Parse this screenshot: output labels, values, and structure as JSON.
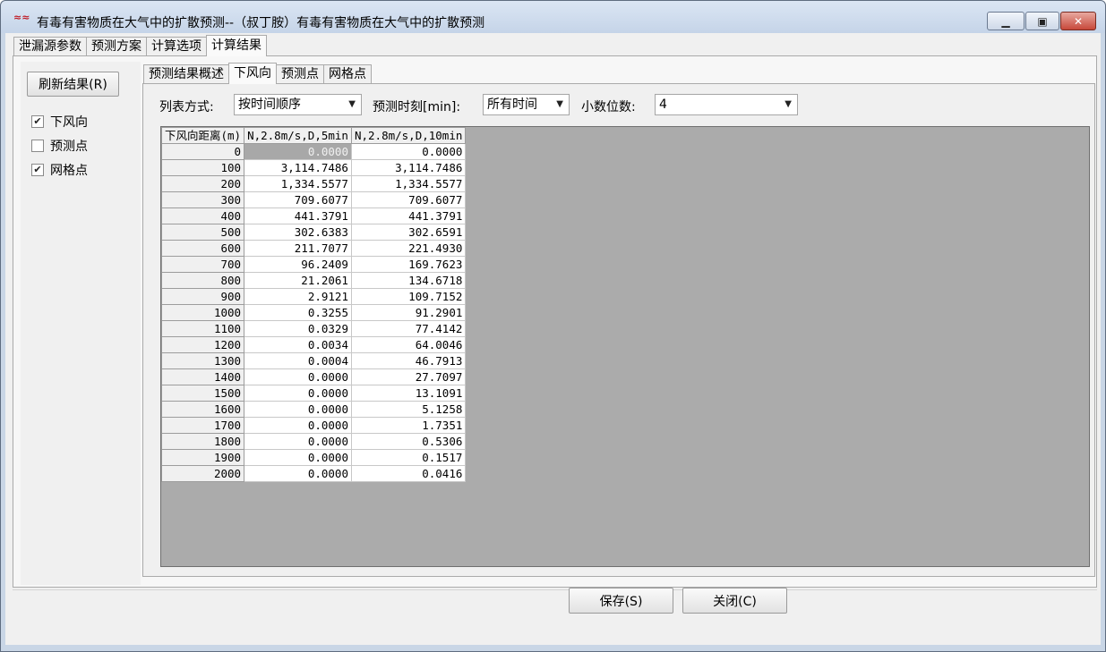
{
  "window": {
    "title": "有毒有害物质在大气中的扩散预测--（叔丁胺）有毒有害物质在大气中的扩散预测",
    "minimize_label": "▁",
    "maximize_label": "▣",
    "close_label": "✕"
  },
  "top_tabs": [
    "泄漏源参数",
    "预测方案",
    "计算选项",
    "计算结果"
  ],
  "left_panel": {
    "refresh_label": "刷新结果(R)",
    "checkboxes": [
      {
        "label": "下风向",
        "checked": true
      },
      {
        "label": "预测点",
        "checked": false
      },
      {
        "label": "网格点",
        "checked": true
      }
    ]
  },
  "inner_tabs": [
    "预测结果概述",
    "下风向",
    "预测点",
    "网格点"
  ],
  "controls": {
    "list_mode_label": "列表方式:",
    "list_mode_value": "按时间顺序",
    "time_label": "预测时刻[min]:",
    "time_value": "所有时间",
    "decimals_label": "小数位数:",
    "decimals_value": "4"
  },
  "table": {
    "headers": [
      "下风向距离(m)",
      "N,2.8m/s,D,5min",
      "N,2.8m/s,D,10min"
    ],
    "rows": [
      [
        "0",
        "0.0000",
        "0.0000"
      ],
      [
        "100",
        "3,114.7486",
        "3,114.7486"
      ],
      [
        "200",
        "1,334.5577",
        "1,334.5577"
      ],
      [
        "300",
        "709.6077",
        "709.6077"
      ],
      [
        "400",
        "441.3791",
        "441.3791"
      ],
      [
        "500",
        "302.6383",
        "302.6591"
      ],
      [
        "600",
        "211.7077",
        "221.4930"
      ],
      [
        "700",
        "96.2409",
        "169.7623"
      ],
      [
        "800",
        "21.2061",
        "134.6718"
      ],
      [
        "900",
        "2.9121",
        "109.7152"
      ],
      [
        "1000",
        "0.3255",
        "91.2901"
      ],
      [
        "1100",
        "0.0329",
        "77.4142"
      ],
      [
        "1200",
        "0.0034",
        "64.0046"
      ],
      [
        "1300",
        "0.0004",
        "46.7913"
      ],
      [
        "1400",
        "0.0000",
        "27.7097"
      ],
      [
        "1500",
        "0.0000",
        "13.1091"
      ],
      [
        "1600",
        "0.0000",
        "5.1258"
      ],
      [
        "1700",
        "0.0000",
        "1.7351"
      ],
      [
        "1800",
        "0.0000",
        "0.5306"
      ],
      [
        "1900",
        "0.0000",
        "0.1517"
      ],
      [
        "2000",
        "0.0000",
        "0.0416"
      ]
    ]
  },
  "buttons": {
    "save_label": "保存(S)",
    "close_label": "关闭(C)"
  }
}
